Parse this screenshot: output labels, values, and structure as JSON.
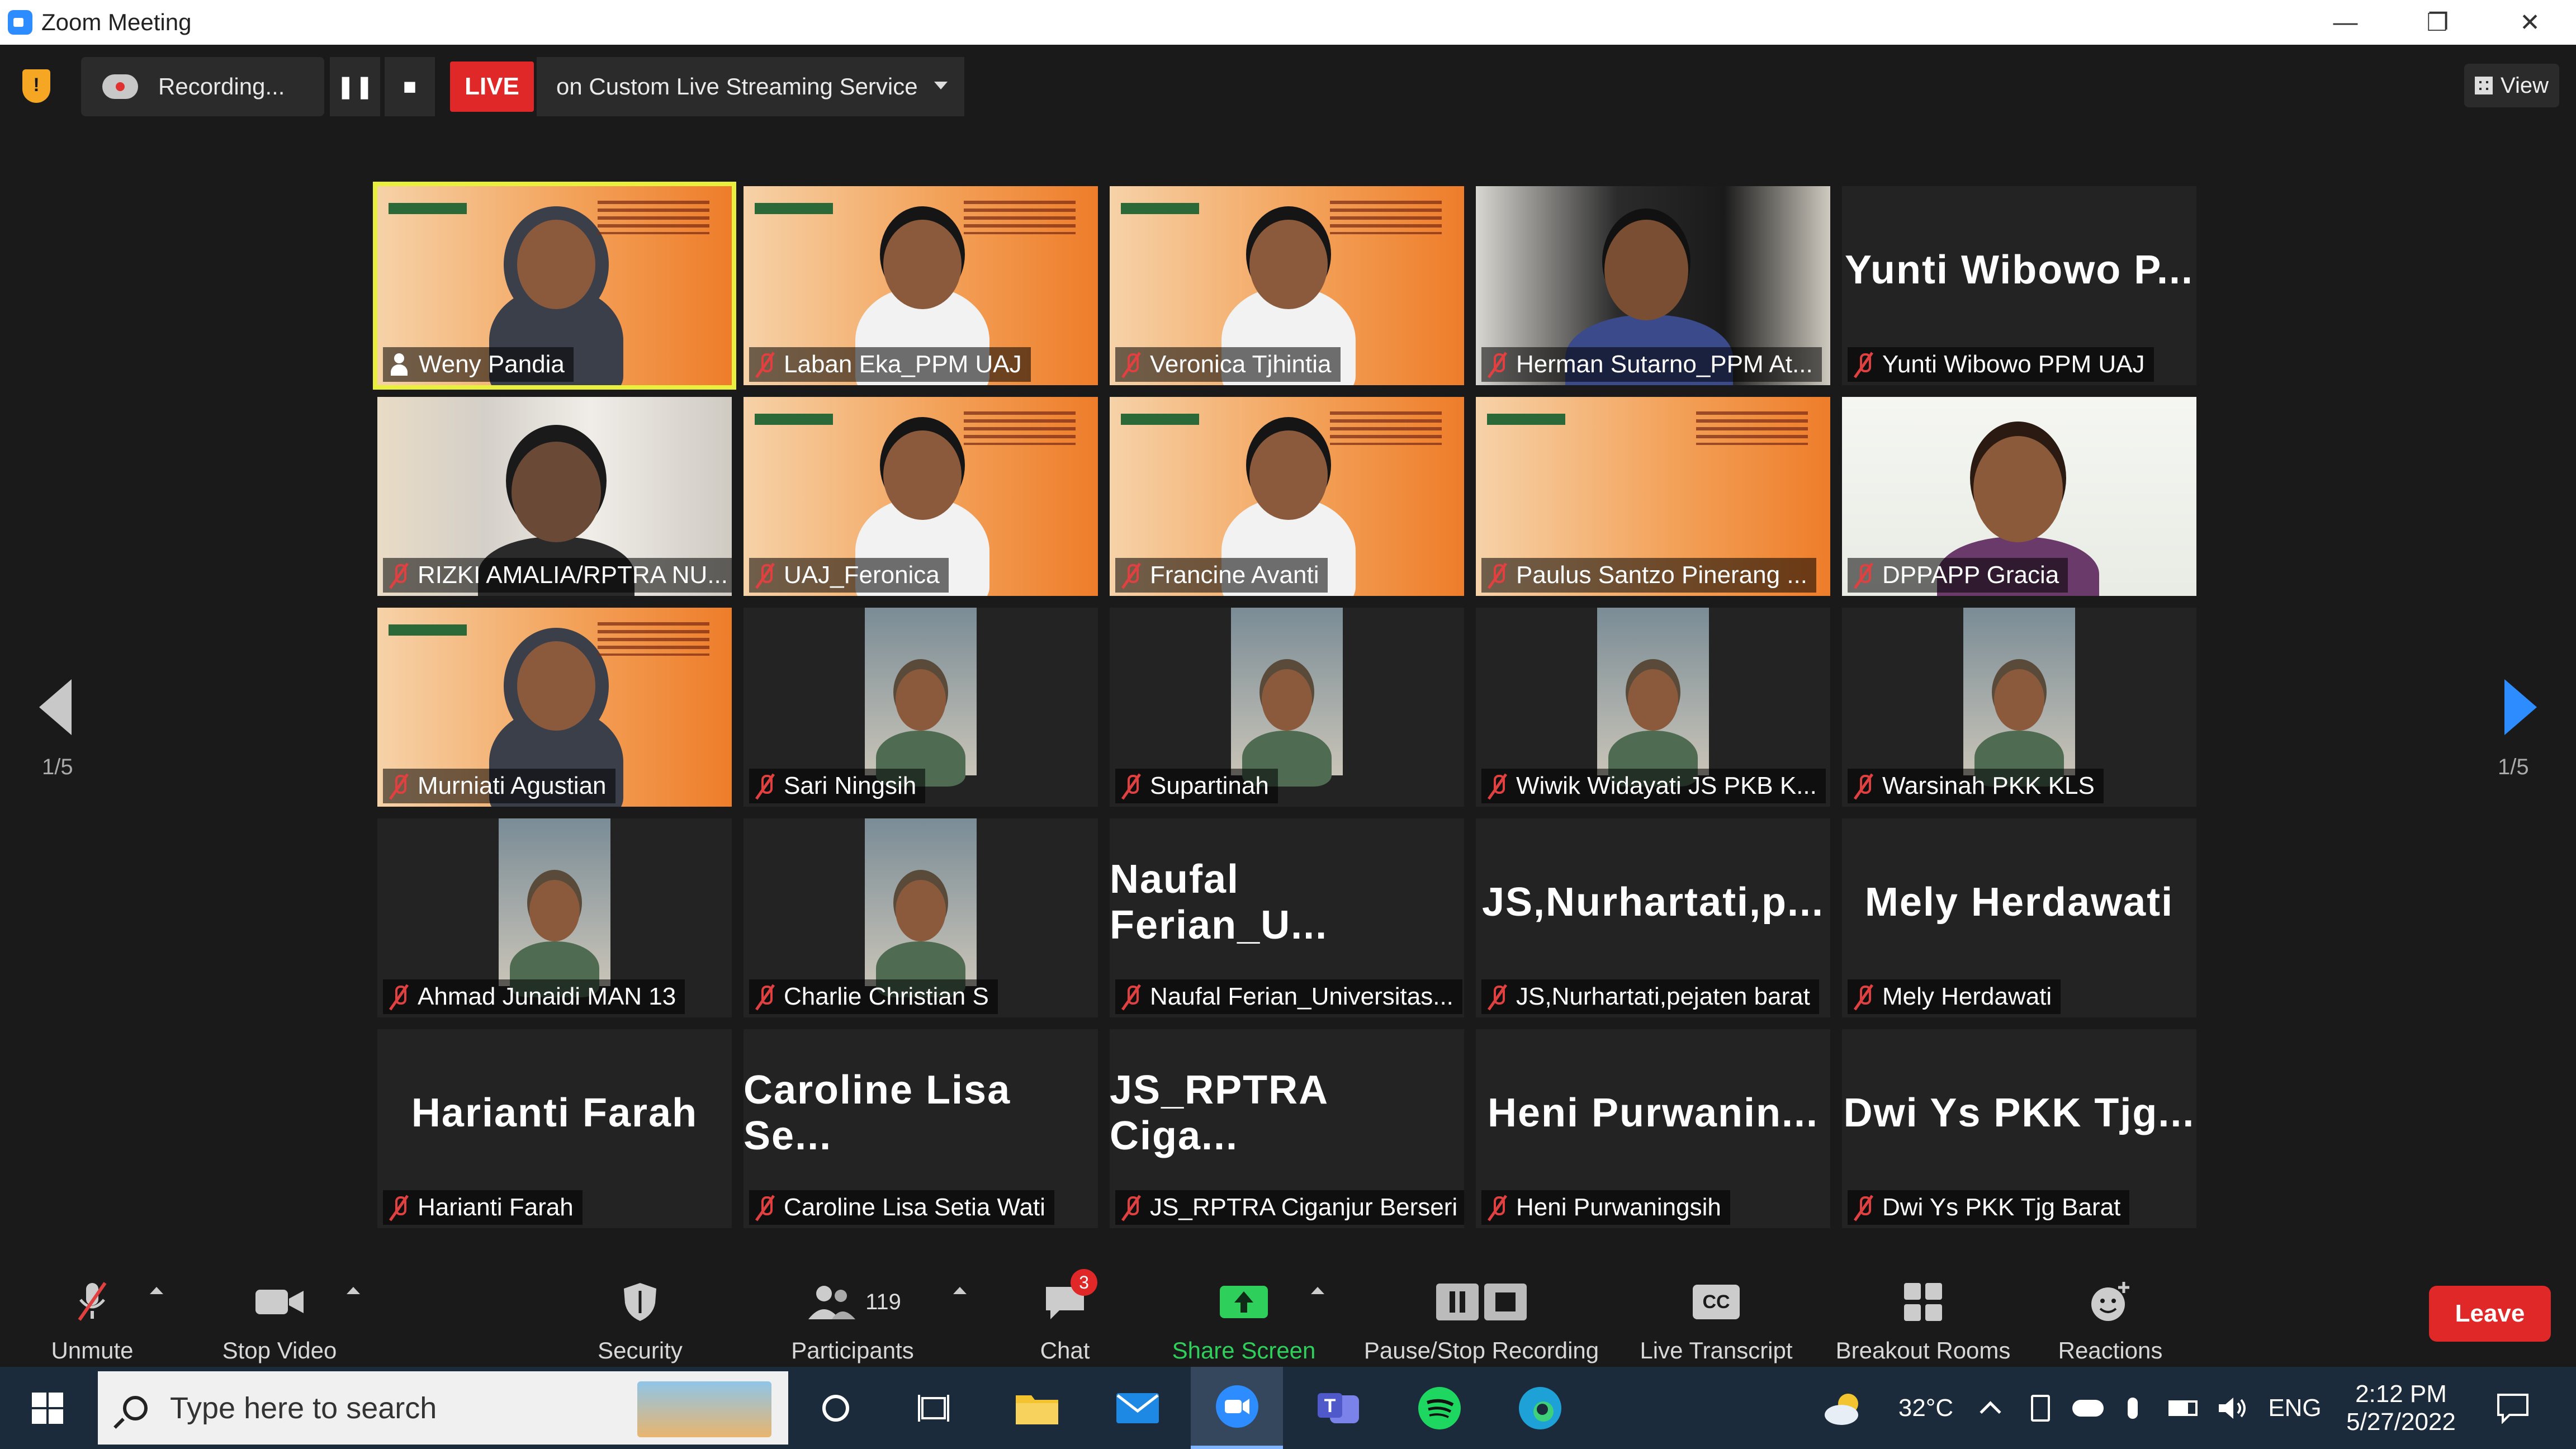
{
  "window": {
    "title": "Zoom Meeting",
    "controls": [
      "—",
      "❐",
      "✕"
    ]
  },
  "topbar": {
    "recording_label": "Recording...",
    "live_label": "LIVE",
    "stream_label": "on Custom Live Streaming Service",
    "view_label": "View"
  },
  "gallery": {
    "page_left": "1/5",
    "page_right": "1/5",
    "participants": [
      {
        "name": "Weny Pandia",
        "video": "banner-woman-hijab",
        "status": "speaking",
        "active": true
      },
      {
        "name": "Laban Eka_PPM UAJ",
        "video": "banner-man",
        "status": "muted"
      },
      {
        "name": "Veronica Tjhintia",
        "video": "banner-woman",
        "status": "muted"
      },
      {
        "name": "Herman Sutarno_PPM At...",
        "video": "office-man",
        "status": "muted"
      },
      {
        "name": "Yunti Wibowo PPM UAJ",
        "video": "none",
        "big": "Yunti Wibowo P...",
        "status": "muted"
      },
      {
        "name": "RIZKI AMALIA/RPTRA NU...",
        "video": "room-woman",
        "status": "muted"
      },
      {
        "name": "UAJ_Feronica",
        "video": "banner-woman2",
        "status": "muted"
      },
      {
        "name": "Francine Avanti",
        "video": "banner-woman3",
        "status": "muted"
      },
      {
        "name": "Paulus Santzo Pinerang ...",
        "video": "banner-empty",
        "status": "muted"
      },
      {
        "name": "DPPAPP Gracia",
        "video": "white-woman",
        "status": "muted"
      },
      {
        "name": "Murniati Agustian",
        "video": "banner-woman-hijab2",
        "status": "muted"
      },
      {
        "name": "Sari Ningsih",
        "video": "phone-woman",
        "status": "muted"
      },
      {
        "name": "Supartinah",
        "video": "phone-woman2",
        "status": "muted"
      },
      {
        "name": "Wiwik Widayati JS PKB K...",
        "video": "phone-woman3",
        "status": "muted"
      },
      {
        "name": "Warsinah PKK KLS",
        "video": "phone-woman4",
        "status": "muted"
      },
      {
        "name": "Ahmad Junaidi MAN 13",
        "video": "phone-man",
        "status": "muted"
      },
      {
        "name": "Charlie Christian S",
        "video": "phone-man2",
        "status": "muted"
      },
      {
        "name": "Naufal Ferian_Universitas...",
        "video": "none",
        "big": "Naufal Ferian_U...",
        "status": "muted"
      },
      {
        "name": "JS,Nurhartati,pejaten barat",
        "video": "none",
        "big": "JS,Nurhartati,p...",
        "status": "muted"
      },
      {
        "name": "Mely Herdawati",
        "video": "none",
        "big": "Mely Herdawati",
        "status": "muted"
      },
      {
        "name": "Harianti Farah",
        "video": "none",
        "big": "Harianti Farah",
        "status": "muted"
      },
      {
        "name": "Caroline Lisa Setia Wati",
        "video": "none",
        "big": "Caroline Lisa Se...",
        "status": "muted"
      },
      {
        "name": "JS_RPTRA Ciganjur Berseri",
        "video": "none",
        "big": "JS_RPTRA Ciga...",
        "status": "muted"
      },
      {
        "name": "Heni Purwaningsih",
        "video": "none",
        "big": "Heni Purwanin...",
        "status": "muted"
      },
      {
        "name": "Dwi Ys PKK Tjg Barat",
        "video": "none",
        "big": "Dwi Ys PKK Tjg...",
        "status": "muted"
      }
    ]
  },
  "toolbar": {
    "unmute": "Unmute",
    "stop_video": "Stop Video",
    "security": "Security",
    "participants": "Participants",
    "participants_count": "119",
    "chat": "Chat",
    "chat_badge": "3",
    "share_screen": "Share Screen",
    "pause_stop_recording": "Pause/Stop Recording",
    "live_transcript": "Live Transcript",
    "live_transcript_icon": "CC",
    "breakout_rooms": "Breakout Rooms",
    "reactions": "Reactions",
    "leave": "Leave"
  },
  "taskbar": {
    "search_placeholder": "Type here to search",
    "temperature": "32°C",
    "language": "ENG",
    "time": "2:12 PM",
    "date": "5/27/2022"
  },
  "colors": {
    "active_speaker": "#e8ef3c",
    "live_red": "#e02828",
    "share_green": "#2ecf5b",
    "zoom_blue": "#2d8cff"
  }
}
